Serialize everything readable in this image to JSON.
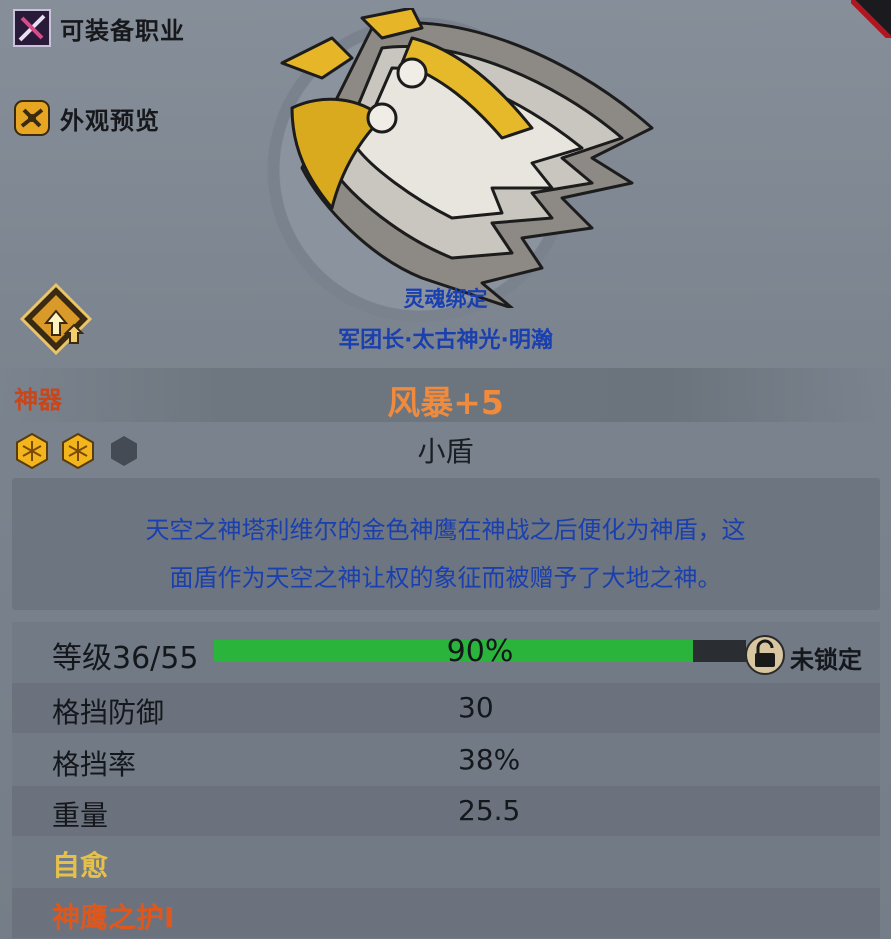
{
  "sidebar": {
    "equippable_classes": {
      "label": "可装备职业",
      "icon": "crossed-sword-icon"
    },
    "appearance_preview": {
      "label": "外观预览",
      "icon": "hanger-icon"
    },
    "upgrade": {
      "icon": "upgrade-arrow-icon"
    }
  },
  "item": {
    "binding": "灵魂绑定",
    "bound_to": "军团长·太古神光·明瀚",
    "category": "神器",
    "name": "风暴+5",
    "type": "小盾",
    "gems": {
      "filled": 2,
      "total": 3
    },
    "description_lines": [
      "天空之神塔利维尔的金色神鹰在神战之后便化为神盾，这",
      "面盾作为天空之神让权的象征而被赠予了大地之神。"
    ]
  },
  "level": {
    "label": "等级36/55",
    "progress": 0.9,
    "progress_text": "90%",
    "lock_status": "未锁定"
  },
  "stats": [
    {
      "label": "格挡防御",
      "value": "30"
    },
    {
      "label": "格挡率",
      "value": "38%"
    },
    {
      "label": "重量",
      "value": "25.5"
    }
  ],
  "skills": [
    {
      "label": "自愈"
    },
    {
      "label": "神鹰之护I"
    }
  ],
  "colors": {
    "binding_blue": "#1a3fae",
    "artifact_orange": "#c8461a",
    "name_orange": "#f08a3c",
    "progress_green": "#2ab43c",
    "skill_gold": "#e6c14a",
    "skill_orange": "#e0571c"
  }
}
